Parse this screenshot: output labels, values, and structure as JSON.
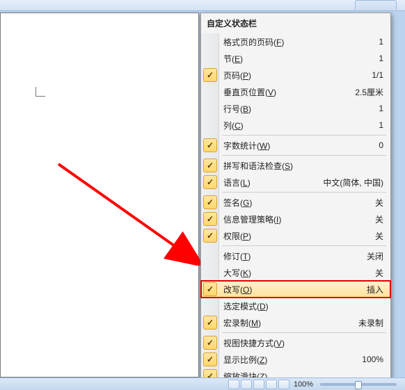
{
  "menu": {
    "title": "自定义状态栏",
    "items": [
      {
        "label_pre": "格式页的页码(",
        "hot": "F",
        "label_post": ")",
        "value": "1",
        "checked": false,
        "sepAfter": false
      },
      {
        "label_pre": "节(",
        "hot": "E",
        "label_post": ")",
        "value": "1",
        "checked": false,
        "sepAfter": false
      },
      {
        "label_pre": "页码(",
        "hot": "P",
        "label_post": ")",
        "value": "1/1",
        "checked": true,
        "sepAfter": false
      },
      {
        "label_pre": "垂直页位置(",
        "hot": "V",
        "label_post": ")",
        "value": "2.5厘米",
        "checked": false,
        "sepAfter": false
      },
      {
        "label_pre": "行号(",
        "hot": "B",
        "label_post": ")",
        "value": "1",
        "checked": false,
        "sepAfter": false
      },
      {
        "label_pre": "列(",
        "hot": "C",
        "label_post": ")",
        "value": "1",
        "checked": false,
        "sepAfter": true
      },
      {
        "label_pre": "字数统计(",
        "hot": "W",
        "label_post": ")",
        "value": "0",
        "checked": true,
        "sepAfter": true
      },
      {
        "label_pre": "拼写和语法检查(",
        "hot": "S",
        "label_post": ")",
        "value": "",
        "checked": true,
        "sepAfter": false
      },
      {
        "label_pre": "语言(",
        "hot": "L",
        "label_post": ")",
        "value": "中文(简体, 中国)",
        "checked": true,
        "sepAfter": true
      },
      {
        "label_pre": "签名(",
        "hot": "G",
        "label_post": ")",
        "value": "关",
        "checked": true,
        "sepAfter": false
      },
      {
        "label_pre": "信息管理策略(",
        "hot": "I",
        "label_post": ")",
        "value": "关",
        "checked": true,
        "sepAfter": false
      },
      {
        "label_pre": "权限(",
        "hot": "P",
        "label_post": ")",
        "value": "关",
        "checked": true,
        "sepAfter": true
      },
      {
        "label_pre": "修订(",
        "hot": "T",
        "label_post": ")",
        "value": "关闭",
        "checked": false,
        "sepAfter": false
      },
      {
        "label_pre": "大写(",
        "hot": "K",
        "label_post": ")",
        "value": "关",
        "checked": false,
        "sepAfter": false
      },
      {
        "label_pre": "改写(",
        "hot": "O",
        "label_post": ")",
        "value": "插入",
        "checked": true,
        "sepAfter": false,
        "highlight": true
      },
      {
        "label_pre": "选定模式(",
        "hot": "D",
        "label_post": ")",
        "value": "",
        "checked": false,
        "sepAfter": false
      },
      {
        "label_pre": "宏录制(",
        "hot": "M",
        "label_post": ")",
        "value": "未录制",
        "checked": true,
        "sepAfter": true
      },
      {
        "label_pre": "视图快捷方式(",
        "hot": "V",
        "label_post": ")",
        "value": "",
        "checked": true,
        "sepAfter": false
      },
      {
        "label_pre": "显示比例(",
        "hot": "Z",
        "label_post": ")",
        "value": "100%",
        "checked": true,
        "sepAfter": false
      },
      {
        "label_pre": "缩放滑块(",
        "hot": "Z",
        "label_post": ")",
        "value": "",
        "checked": true,
        "sepAfter": false
      }
    ]
  },
  "statusbar": {
    "zoom_label": "100%"
  }
}
